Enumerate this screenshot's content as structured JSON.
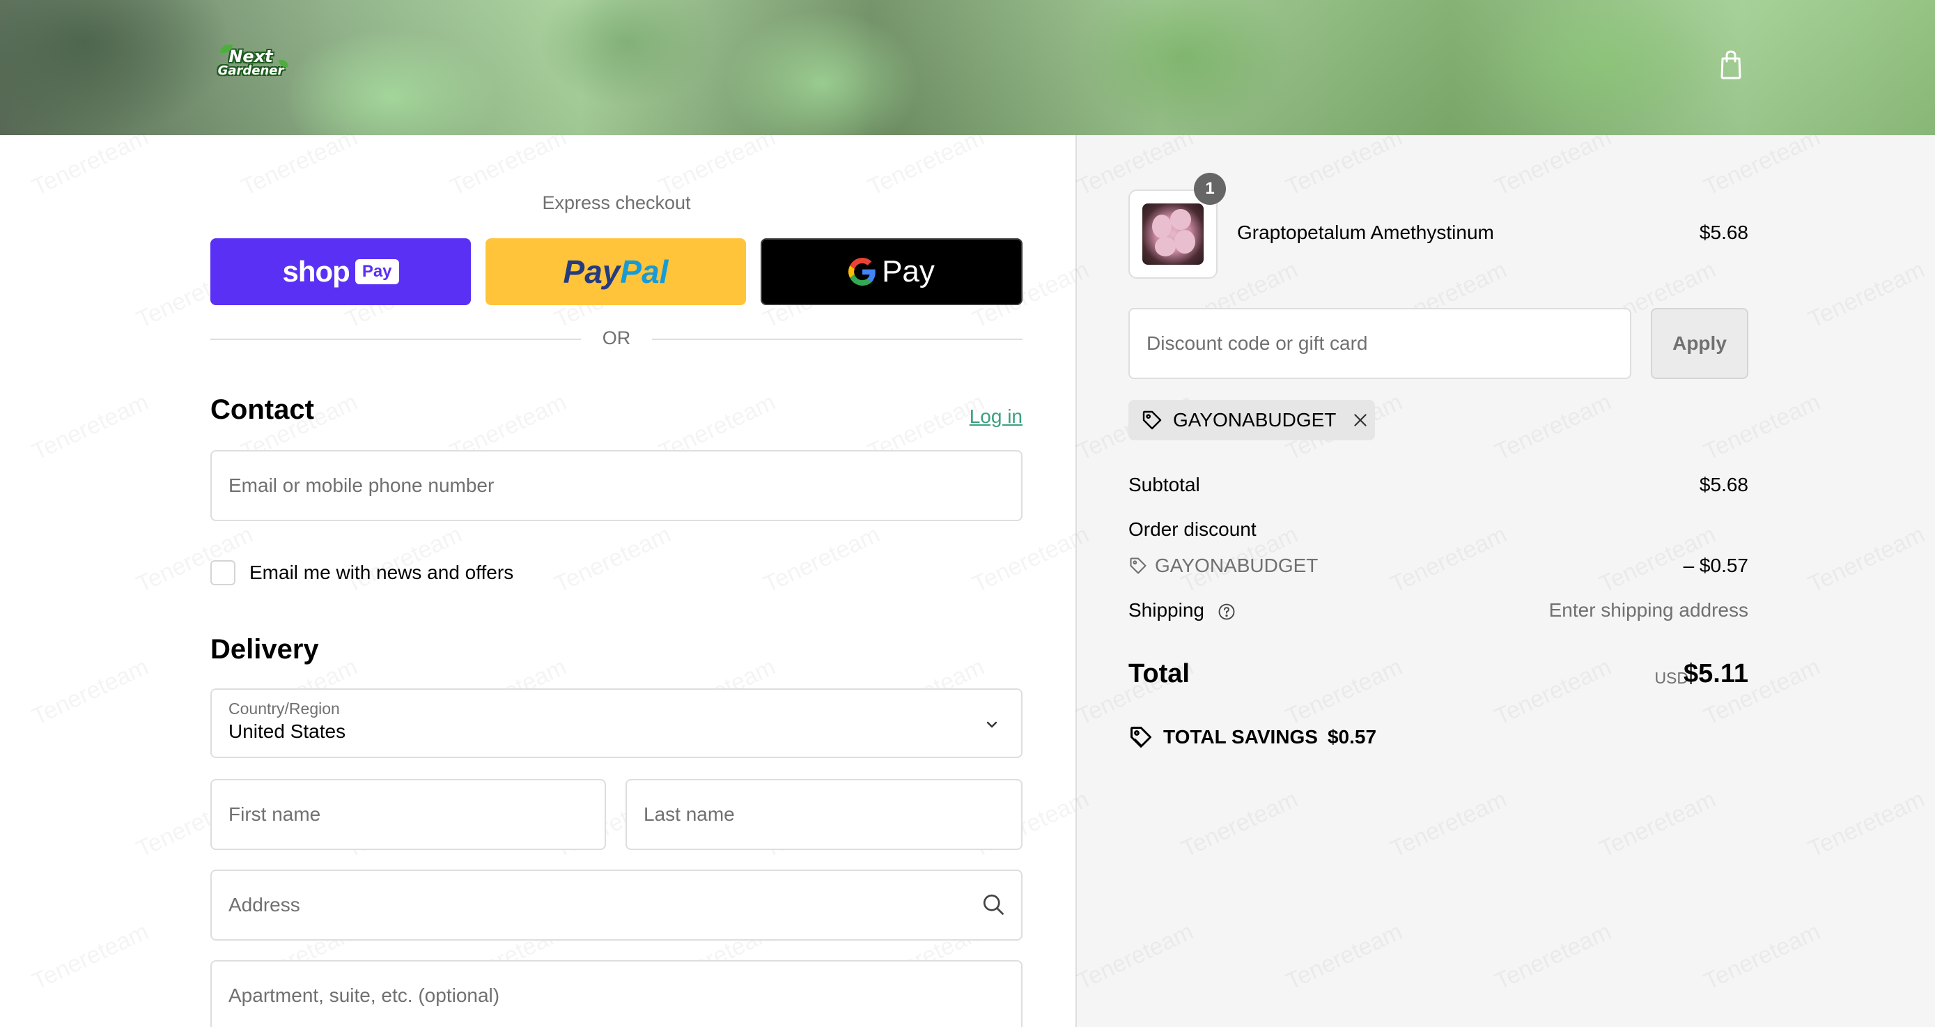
{
  "header": {
    "logo_line1": "Next",
    "logo_line2": "Gardener",
    "logo_alt": "Next Gardener"
  },
  "express": {
    "title": "Express checkout",
    "shop_pay_text": "shop",
    "shop_pay_pill": "Pay",
    "paypal_text_a": "Pay",
    "paypal_text_b": "Pal",
    "gpay_text": "Pay",
    "or_text": "OR"
  },
  "contact": {
    "title": "Contact",
    "login_link": "Log in",
    "email_placeholder": "Email or mobile phone number",
    "newsletter_label": "Email me with news and offers",
    "newsletter_checked": false
  },
  "delivery": {
    "title": "Delivery",
    "country_label": "Country/Region",
    "country_value": "United States",
    "first_name_placeholder": "First name",
    "last_name_placeholder": "Last name",
    "address_placeholder": "Address",
    "apartment_placeholder": "Apartment, suite, etc. (optional)"
  },
  "order": {
    "item": {
      "quantity": "1",
      "name": "Graptopetalum Amethystinum",
      "price": "$5.68"
    },
    "discount_placeholder": "Discount code or gift card",
    "apply_label": "Apply",
    "applied_code": "GAYONABUDGET",
    "subtotal_label": "Subtotal",
    "subtotal_value": "$5.68",
    "order_discount_label": "Order discount",
    "discount_code": "GAYONABUDGET",
    "discount_value": "– $0.57",
    "shipping_label": "Shipping",
    "shipping_value": "Enter shipping address",
    "total_label": "Total",
    "total_currency": "USD",
    "total_value": "$5.11",
    "savings_label": "TOTAL SAVINGS",
    "savings_value": "$0.57"
  },
  "watermark_text": "Tenereteam",
  "colors": {
    "shop_pay": "#5a31f4",
    "paypal": "#ffc43a",
    "gpay": "#000000",
    "link": "#3aa17e",
    "summary_bg": "#f5f5f5"
  }
}
